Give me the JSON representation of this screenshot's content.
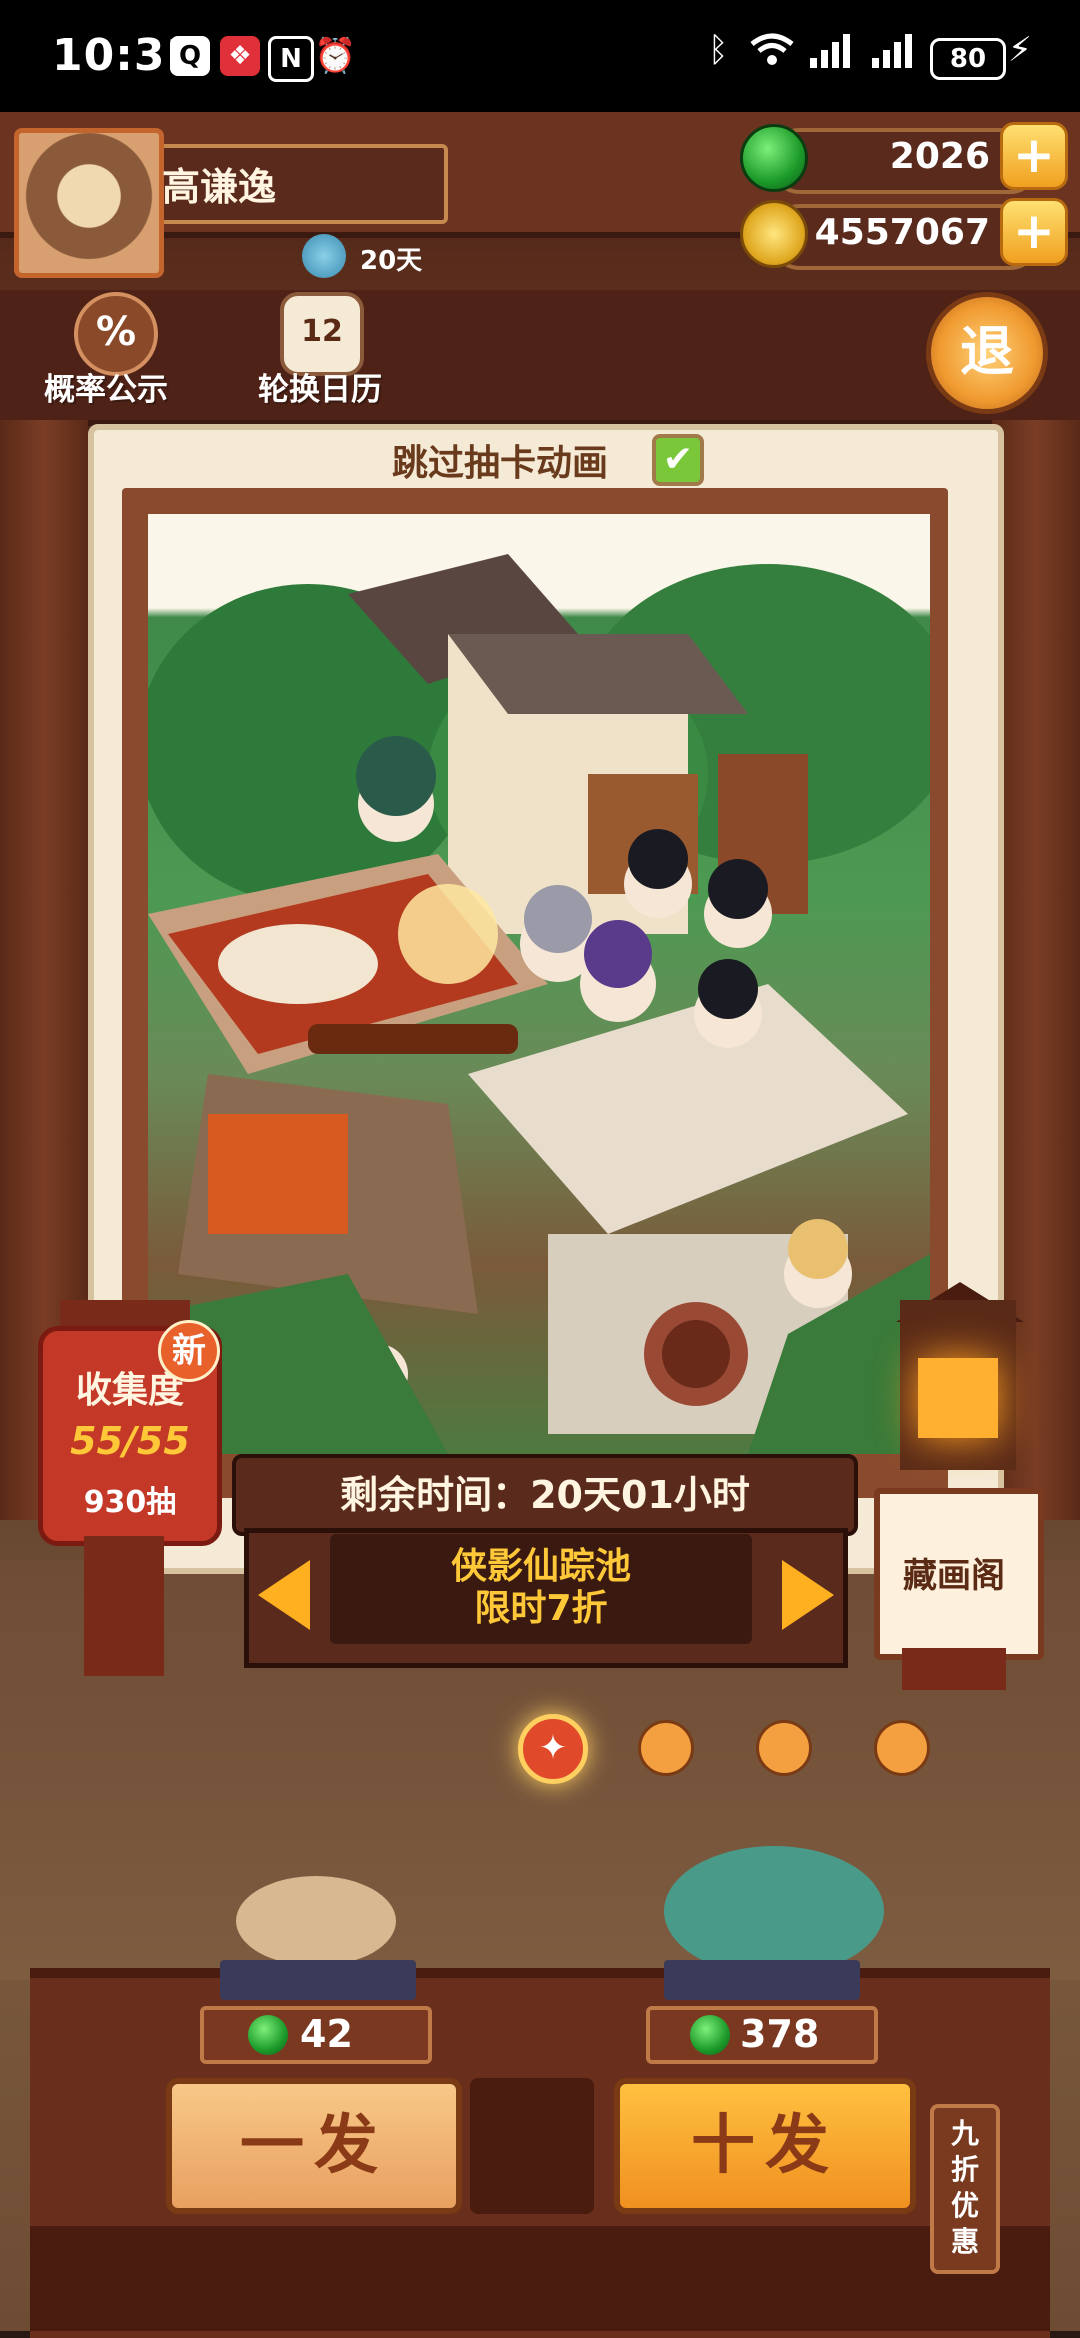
{
  "status_bar": {
    "time": "10:31",
    "battery": "80",
    "icons_left": [
      "qq-icon",
      "gift-icon",
      "nfc-icon",
      "alarm-icon"
    ],
    "icons_right": [
      "bluetooth-icon",
      "wifi-icon",
      "signal-icon",
      "signal-icon",
      "charging-icon"
    ]
  },
  "player": {
    "name": "高谦逸",
    "days": "20天"
  },
  "currency": {
    "jade": "2026",
    "coins": "4557067",
    "plus": "+"
  },
  "menu": {
    "odds_label": "概率公示",
    "odds_icon": "%",
    "calendar_label": "轮换日历",
    "calendar_icon": "12",
    "exit_label": "退"
  },
  "card": {
    "skip_label": "跳过抽卡动画",
    "skip_checked": "✔"
  },
  "collection": {
    "new_badge": "新",
    "title": "收集度",
    "progress": "55/55",
    "draws": "930抽"
  },
  "banner": {
    "time_left": "剩余时间：20天01小时",
    "pool_name": "侠影仙踪池",
    "pool_sale": "限时7折",
    "gallery": "藏画阁"
  },
  "draw": {
    "single_price": "42",
    "single_label": "一发",
    "ten_price": "378",
    "ten_label": "十发",
    "discount": "九折优惠"
  },
  "colors": {
    "accent": "#ffb020",
    "wood": "#6a2e1c",
    "jade": "#1c9a2a"
  }
}
